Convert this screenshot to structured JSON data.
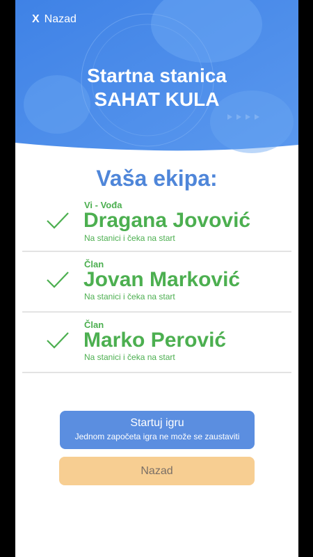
{
  "header": {
    "back_label": "Nazad",
    "close_glyph": "X",
    "station_label": "Startna stanica",
    "station_name": "SAHAT KULA"
  },
  "team": {
    "title": "Vaša ekipa:",
    "members": [
      {
        "role": "Vi - Vođa",
        "name": "Dragana Jovović",
        "status": "Na stanici i čeka na start"
      },
      {
        "role": "Član",
        "name": "Jovan Marković",
        "status": "Na stanici i čeka na start"
      },
      {
        "role": "Član",
        "name": "Marko Perović",
        "status": "Na stanici i čeka na start"
      }
    ]
  },
  "actions": {
    "start_label": "Startuj igru",
    "start_sub": "Jednom započeta igra ne može se zaustaviti",
    "back_label": "Nazad"
  },
  "colors": {
    "header_blue": "#4a8ae8",
    "accent_blue": "#4f86d9",
    "success_green": "#4caf50",
    "button_blue": "#5b8ee0",
    "button_peach": "#f7ce92"
  }
}
